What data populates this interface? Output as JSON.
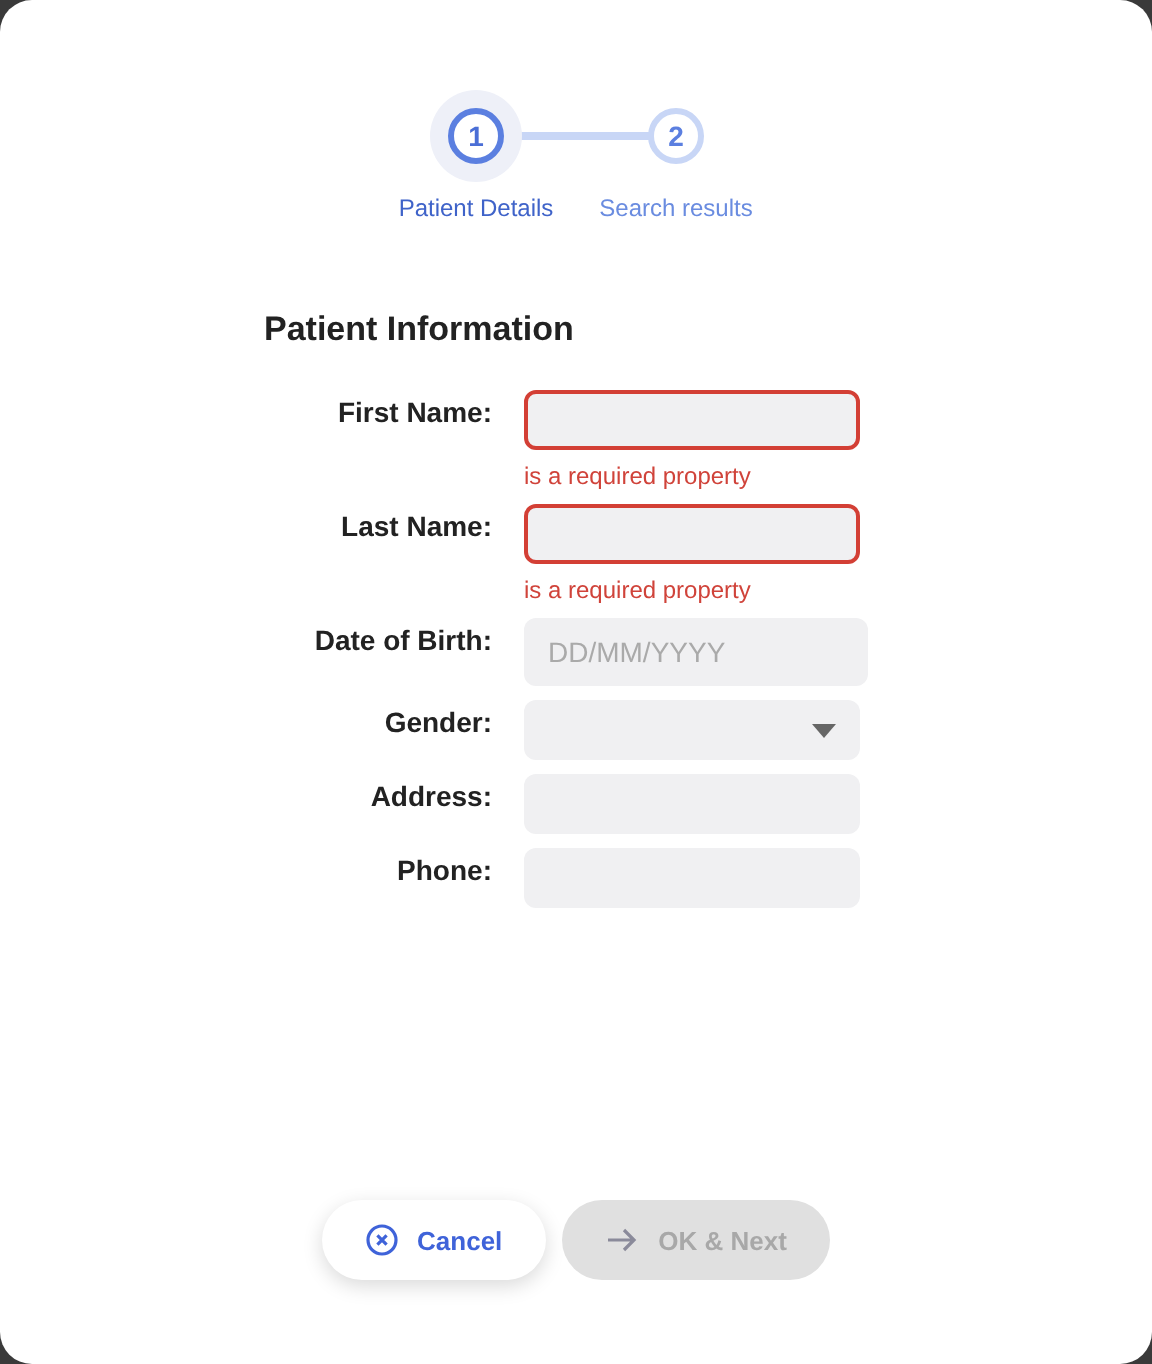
{
  "steps": [
    {
      "number": "1",
      "label": "Patient Details",
      "selected": true
    },
    {
      "number": "2",
      "label": "Search results",
      "selected": false
    }
  ],
  "form": {
    "title": "Patient Information",
    "fields": [
      {
        "label": "First Name:",
        "kind": "text",
        "invalid": true,
        "error": "is a required property"
      },
      {
        "label": "Last Name:",
        "kind": "text",
        "invalid": true,
        "error": "is a required property"
      },
      {
        "label": "Date of Birth:",
        "kind": "date",
        "invalid": false,
        "placeholder": "DD/MM/YYYY"
      },
      {
        "label": "Gender:",
        "kind": "select",
        "invalid": false
      },
      {
        "label": "Address:",
        "kind": "text",
        "invalid": false
      },
      {
        "label": "Phone:",
        "kind": "text",
        "invalid": false
      }
    ]
  },
  "buttons": [
    {
      "label": "Cancel",
      "kind": "cancel",
      "disabled": false
    },
    {
      "label": "OK & Next",
      "kind": "next",
      "disabled": true
    }
  ]
}
